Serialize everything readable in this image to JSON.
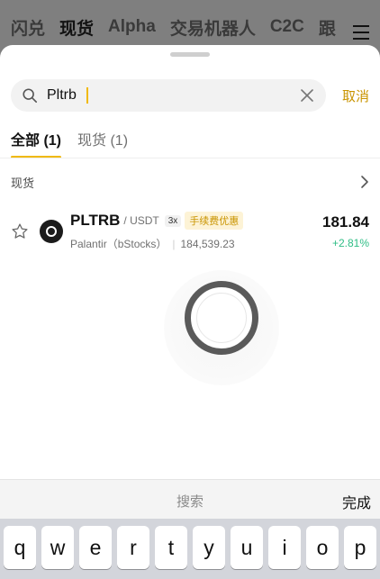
{
  "background_nav": {
    "tabs": [
      "闪兑",
      "现货",
      "Alpha",
      "交易机器人",
      "C2C",
      "跟"
    ],
    "active_index": 1
  },
  "search": {
    "value": "Pltrb",
    "placeholder": "",
    "cancel_label": "取消"
  },
  "filter_tabs": [
    {
      "label": "全部 (1)",
      "active": true
    },
    {
      "label": "现货 (1)",
      "active": false
    }
  ],
  "section": {
    "title": "现货"
  },
  "result": {
    "symbol": "PLTRB",
    "quote": "/ USDT",
    "leverage": "3x",
    "fee_badge": "手续费优惠",
    "name": "Palantir（bStocks）",
    "volume": "184,539.23",
    "price": "181.84",
    "change": "+2.81%"
  },
  "keyboard_bar": {
    "search_label": "搜索",
    "done_label": "完成"
  },
  "keyboard": {
    "keys": [
      "q",
      "w",
      "e",
      "r",
      "t",
      "y",
      "u",
      "i",
      "o",
      "p"
    ]
  },
  "colors": {
    "accent": "#f0b90b",
    "accent_text": "#c99400",
    "positive": "#2ebd85"
  },
  "icons": [
    "search-icon",
    "clear-icon",
    "chevron-right-icon",
    "star-icon",
    "coin-icon",
    "menu-icon",
    "loading-spinner"
  ]
}
